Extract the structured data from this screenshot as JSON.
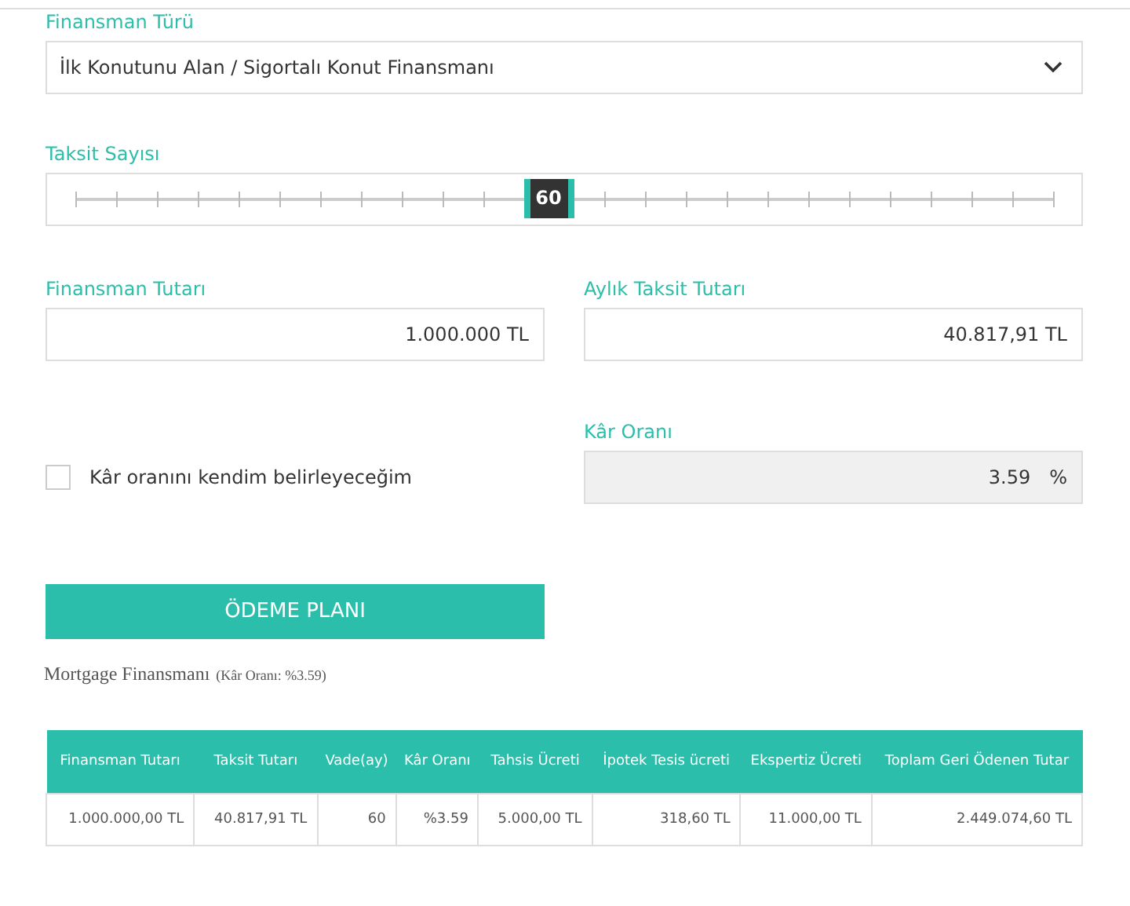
{
  "financing_type": {
    "label": "Finansman Türü",
    "value": "İlk Konutunu Alan / Sigortalı Konut Finansmanı"
  },
  "installments": {
    "label": "Taksit Sayısı",
    "value": "60",
    "level": 0.484
  },
  "amount": {
    "label": "Finansman Tutarı",
    "value": "1.000.000 TL"
  },
  "monthly": {
    "label": "Aylık Taksit Tutarı",
    "value": "40.817,91 TL"
  },
  "custom_rate": {
    "label": "Kâr oranını kendim belirleyeceğim",
    "checked": false
  },
  "rate": {
    "label": "Kâr Oranı",
    "value": "3.59",
    "unit": "%",
    "disabled": true
  },
  "button": "ÖDEME PLANI",
  "result": {
    "title": "Mortgage Finansmanı",
    "note": "(Kâr Oranı: %3.59)"
  },
  "table": {
    "columns": [
      "Finansman Tutarı",
      "Taksit Tutarı",
      "Vade(ay)",
      "Kâr Oranı",
      "Tahsis Ücreti",
      "İpotek Tesis ücreti",
      "Ekspertiz Ücreti",
      "Toplam Geri Ödenen Tutar"
    ],
    "rows": [
      [
        "1.000.000,00 TL",
        "40.817,91 TL",
        "60",
        "%3.59",
        "5.000,00 TL",
        "318,60 TL",
        "11.000,00 TL",
        "2.449.074,60 TL"
      ]
    ]
  }
}
